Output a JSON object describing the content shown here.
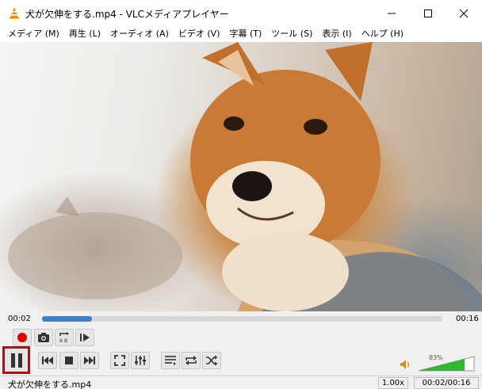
{
  "window": {
    "title": "犬が欠伸をする.mp4 - VLCメディアプレイヤー"
  },
  "menu": [
    "メディア (M)",
    "再生 (L)",
    "オーディオ (A)",
    "ビデオ (V)",
    "字幕 (T)",
    "ツール (S)",
    "表示 (I)",
    "ヘルプ (H)"
  ],
  "playback": {
    "elapsed": "00:02",
    "total": "00:16",
    "progress_fraction": 0.125
  },
  "controls": {
    "top_row_icons": [
      "record-icon",
      "snapshot-icon",
      "ab-loop-icon",
      "frame-step-icon"
    ],
    "bottom_row_icons": [
      "pause-icon",
      "previous-icon",
      "stop-icon",
      "next-icon",
      "fullscreen-icon",
      "extended-settings-icon",
      "playlist-icon",
      "loop-icon",
      "shuffle-icon"
    ]
  },
  "volume": {
    "label": "83%",
    "level_fraction": 0.83,
    "accent": "#2eb82e"
  },
  "status": {
    "filename": "犬が欠伸をする.mp4",
    "speed": "1.00x",
    "time": "00:02/00:16"
  },
  "colors": {
    "seek_fill": "#3a82d0",
    "highlight": "#d60000",
    "record": "#e00000"
  }
}
